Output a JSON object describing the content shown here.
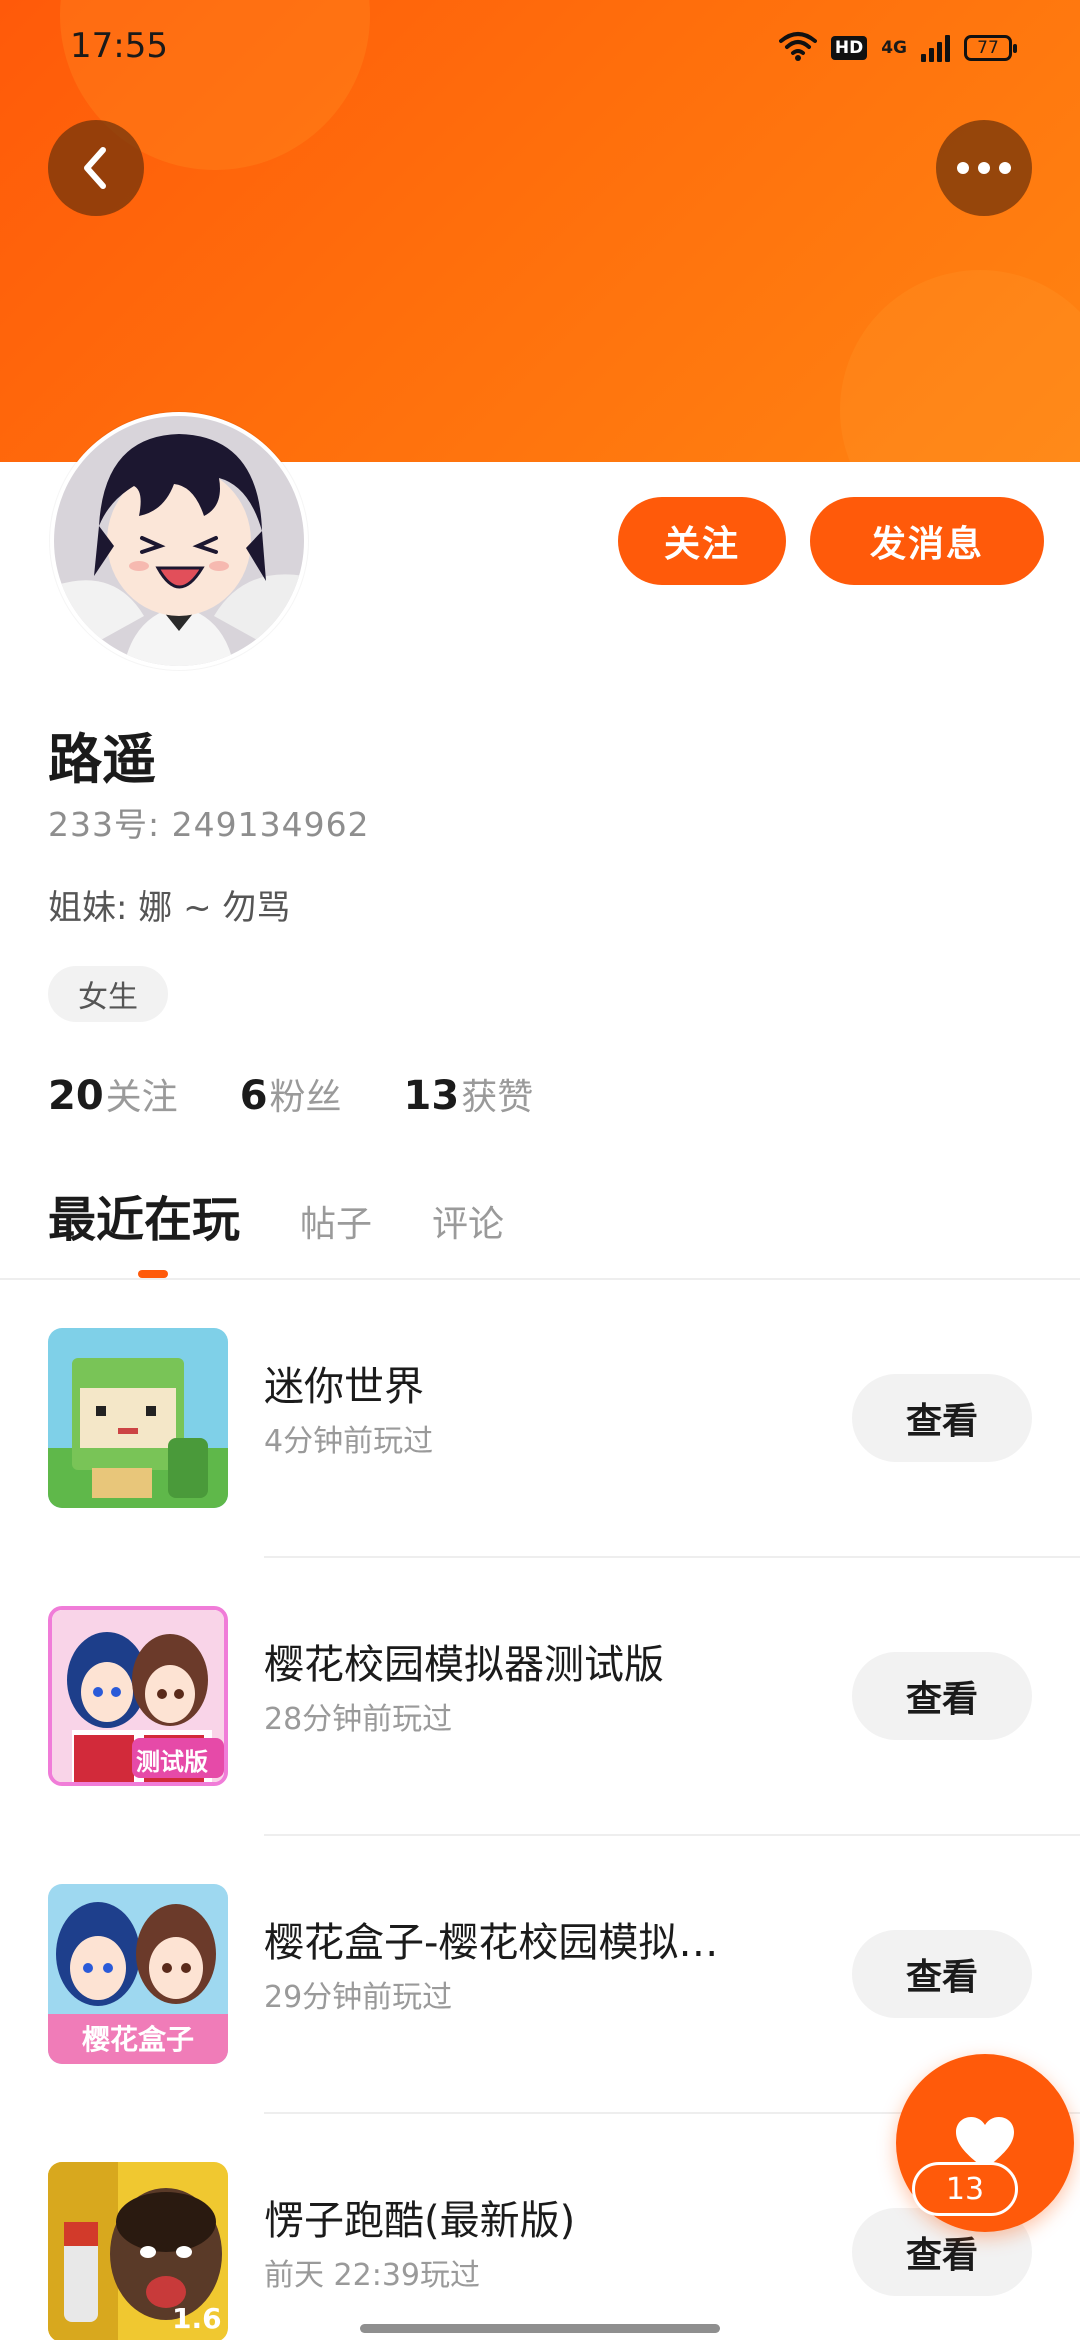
{
  "status_bar": {
    "time": "17:55",
    "hd_label": "HD",
    "network_label": "4G",
    "battery": "77"
  },
  "header": {
    "back_icon": "chevron-left-icon",
    "more_icon": "more-dots-icon"
  },
  "profile": {
    "name": "路遥",
    "uid_text": "233号: 249134962",
    "bio": "姐妹: 娜 ~ 勿骂",
    "gender_tag": "女生",
    "follow_label": "关注",
    "message_label": "发消息",
    "stats": [
      {
        "number": "20",
        "label": "关注"
      },
      {
        "number": "6",
        "label": "粉丝"
      },
      {
        "number": "13",
        "label": "获赞"
      }
    ]
  },
  "tabs": [
    {
      "label": "最近在玩",
      "active": true
    },
    {
      "label": "帖子",
      "active": false
    },
    {
      "label": "评论",
      "active": false
    }
  ],
  "games": [
    {
      "title": "迷你世界",
      "time": "4分钟前玩过",
      "button": "查看"
    },
    {
      "title": "樱花校园模拟器测试版",
      "time": "28分钟前玩过",
      "button": "查看",
      "icon_badge": "测试版"
    },
    {
      "title": "樱花盒子-樱花校园模拟…",
      "time": "29分钟前玩过",
      "button": "查看",
      "icon_badge": "樱花盒子"
    },
    {
      "title": "愣子跑酷(最新版)",
      "time": "前天 22:39玩过",
      "button": "查看",
      "icon_badge": "1.6"
    }
  ],
  "like_fab": {
    "icon": "heart-icon",
    "count": "13"
  },
  "colors": {
    "accent": "#ff5a0a",
    "banner_start": "#ff5a0a",
    "banner_end": "#ff8412"
  }
}
